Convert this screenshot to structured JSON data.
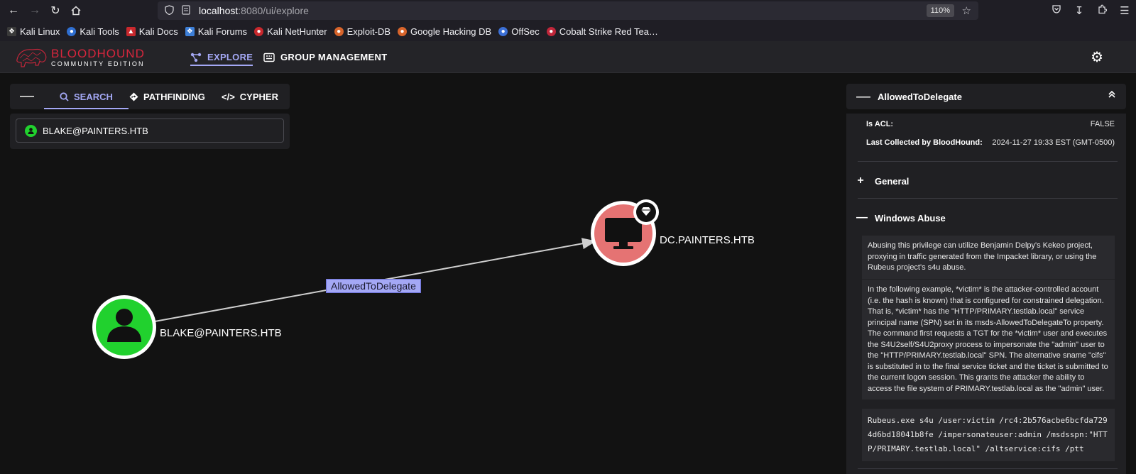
{
  "browser": {
    "url_host": "localhost",
    "url_rest": ":8080/ui/explore",
    "zoom": "110%"
  },
  "bookmarks": [
    {
      "label": "Kali Linux",
      "color": "#1b1b1b"
    },
    {
      "label": "Kali Tools",
      "color": "#2f6fd1"
    },
    {
      "label": "Kali Docs",
      "color": "#c9282d"
    },
    {
      "label": "Kali Forums",
      "color": "#3d7fd8"
    },
    {
      "label": "Kali NetHunter",
      "color": "#c9282d"
    },
    {
      "label": "Exploit-DB",
      "color": "#d8642b"
    },
    {
      "label": "Google Hacking DB",
      "color": "#d8642b"
    },
    {
      "label": "OffSec",
      "color": "#3b6fd6"
    },
    {
      "label": "Cobalt Strike Red Tea…",
      "color": "#c0263a"
    }
  ],
  "app": {
    "logo_line1": "BLOODHOUND",
    "logo_line2": "COMMUNITY EDITION",
    "nav_explore": "EXPLORE",
    "nav_group": "GROUP MANAGEMENT",
    "accent": "#a4a8f5"
  },
  "search": {
    "tab_search": "SEARCH",
    "tab_pathfinding": "PATHFINDING",
    "tab_cypher": "CYPHER",
    "value": "BLAKE@PAINTERS.HTB"
  },
  "graph": {
    "node_user": "BLAKE@PAINTERS.HTB",
    "node_computer": "DC.PAINTERS.HTB",
    "edge": "AllowedToDelegate",
    "user_color": "#21d12e",
    "computer_color": "#e57373"
  },
  "panel": {
    "title": "AllowedToDelegate",
    "is_acl_key": "Is ACL:",
    "is_acl_val": "FALSE",
    "collected_key": "Last Collected by BloodHound:",
    "collected_val": "2024-11-27 19:33 EST (GMT-0500)",
    "section_general": "General",
    "section_windows": "Windows Abuse",
    "para1": "Abusing this privilege can utilize Benjamin Delpy's Kekeo project, proxying in traffic generated from the Impacket library, or using the Rubeus project's s4u abuse.",
    "para2": "In the following example, *victim* is the attacker-controlled account (i.e. the hash is known) that is configured for constrained delegation. That is, *victim* has the \"HTTP/PRIMARY.testlab.local\" service principal name (SPN) set in its msds-AllowedToDelegateTo property. The command first requests a TGT for the *victim* user and executes the S4U2self/S4U2proxy process to impersonate the \"admin\" user to the \"HTTP/PRIMARY.testlab.local\" SPN. The alternative sname \"cifs\" is substituted in to the final service ticket and the ticket is submitted to the current logon session. This grants the attacker the ability to access the file system of PRIMARY.testlab.local as the \"admin\" user.",
    "code": "Rubeus.exe s4u /user:victim /rc4:2b576acbe6bcfda7294d6bd18041b8fe /impersonateuser:admin /msdsspn:\"HTTP/PRIMARY.testlab.local\" /altservice:cifs /ptt"
  }
}
